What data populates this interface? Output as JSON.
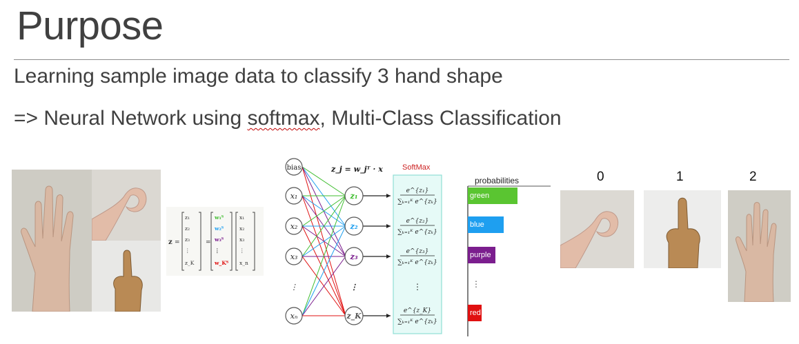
{
  "slide": {
    "title": "Purpose",
    "line1": "Learning sample image data to classify 3 hand shape",
    "line2_prefix": "=> Neural Network using ",
    "line2_softmax": "softmax",
    "line2_suffix": ",  Multi-Class Classification"
  },
  "matrix": {
    "z": "z",
    "eq": "=",
    "z_entries": [
      "z₁",
      "z₂",
      "z₃",
      "⋮",
      "z_K"
    ],
    "w_entries": [
      "w₁ᵀ",
      "w₂ᵀ",
      "w₃ᵀ",
      "⋮",
      "w_Kᵀ"
    ],
    "x_entries": [
      "x₁",
      "x₂",
      "x₃",
      "⋮",
      "x_n"
    ]
  },
  "network": {
    "formula": "z_j = w_jᵀ · x",
    "softmax_label": "SoftMax",
    "bias": "bias",
    "inputs": [
      "x₁",
      "x₂",
      "x₃",
      "⋮",
      "xₙ"
    ],
    "outputs": [
      "z₁",
      "z₂",
      "z₃",
      "⋮",
      "z_K"
    ],
    "softmax_rows": [
      {
        "num": "e^{z₁}",
        "den": "∑ₖ₌₁ᴷ e^{zₖ}"
      },
      {
        "num": "e^{z₂}",
        "den": "∑ₖ₌₁ᴷ e^{zₖ}"
      },
      {
        "num": "e^{z₃}",
        "den": "∑ₖ₌₁ᴷ e^{zₖ}"
      },
      {
        "num": "⋮",
        "den": ""
      },
      {
        "num": "e^{z_K}",
        "den": "∑ₖ₌₁ᴷ e^{zₖ}"
      }
    ],
    "colors": {
      "green": "#3ebd2e",
      "blue": "#1e9ff0",
      "purple": "#7b1e8e",
      "red": "#e01010"
    }
  },
  "probabilities": {
    "title": "probabilities",
    "bars": [
      {
        "label": "green",
        "color": "#5ac531"
      },
      {
        "label": "blue",
        "color": "#1e9ff0"
      },
      {
        "label": "purple",
        "color": "#7b1e8e"
      },
      {
        "label": "⋮",
        "color": ""
      },
      {
        "label": "red",
        "color": "#e01010"
      }
    ]
  },
  "classes": {
    "labels": [
      "0",
      "1",
      "2"
    ]
  }
}
